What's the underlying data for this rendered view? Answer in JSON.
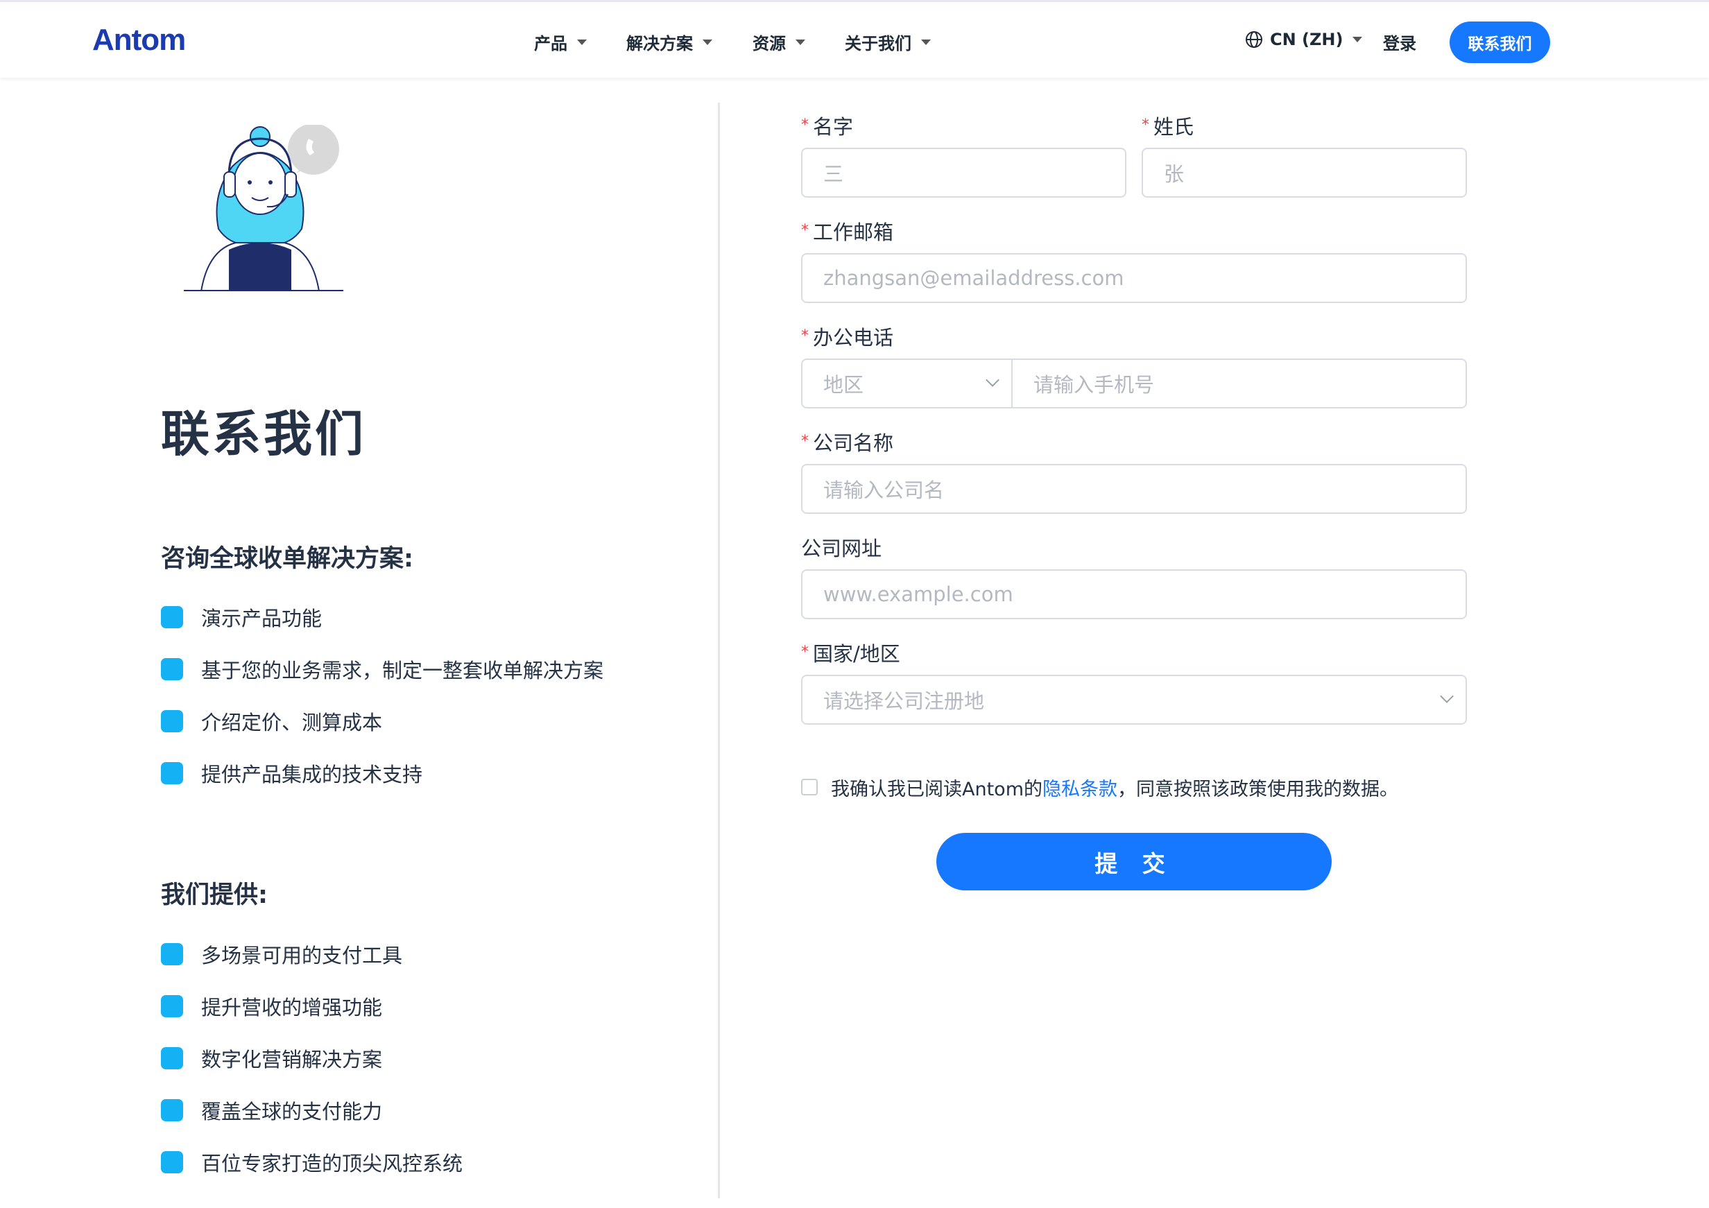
{
  "header": {
    "logo": "Antom",
    "nav": [
      "产品",
      "解决方案",
      "资源",
      "关于我们"
    ],
    "lang": "CN (ZH)",
    "login": "登录",
    "contact": "联系我们"
  },
  "left": {
    "title": "联系我们",
    "consult_title": "咨询全球收单解决方案:",
    "consult_items": [
      "演示产品功能",
      "基于您的业务需求，制定一整套收单解决方案",
      "介绍定价、测算成本",
      "提供产品集成的技术支持"
    ],
    "offer_title": "我们提供:",
    "offer_items": [
      "多场景可用的支付工具",
      "提升营收的增强功能",
      "数字化营销解决方案",
      "覆盖全球的支付能力",
      "百位专家打造的顶尖风控系统"
    ]
  },
  "form": {
    "req_mark": "*",
    "first_name_label": "名字",
    "first_name_placeholder": "三",
    "last_name_label": "姓氏",
    "last_name_placeholder": "张",
    "email_label": "工作邮箱",
    "email_placeholder": "zhangsan@emailaddress.com",
    "phone_label": "办公电话",
    "region_placeholder": "地区",
    "phone_placeholder": "请输入手机号",
    "company_label": "公司名称",
    "company_placeholder": "请输入公司名",
    "website_label": "公司网址",
    "website_placeholder": "www.example.com",
    "country_label": "国家/地区",
    "country_placeholder": "请选择公司注册地",
    "consent_prefix": "我确认我已阅读Antom的",
    "consent_link": "隐私条款",
    "consent_suffix": "，同意按照该政策使用我的数据。",
    "submit": "提 交"
  },
  "colors": {
    "primary": "#1677ff",
    "bullet": "#14b1f5",
    "required": "#e5484d"
  }
}
